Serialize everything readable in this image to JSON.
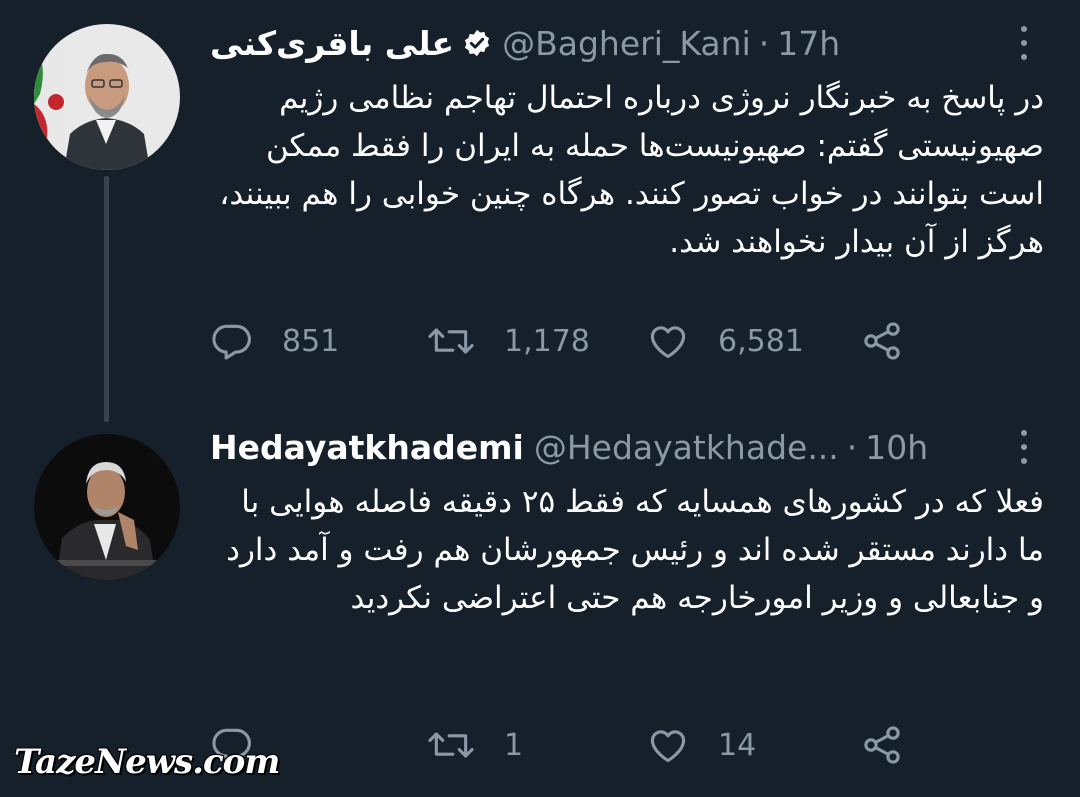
{
  "tweets": [
    {
      "display_name": "علی باقری‌کنی",
      "verified": true,
      "handle": "@Bagheri_Kani",
      "separator": "·",
      "time": "17h",
      "text": "در پاسخ به خبرنگار نروژی درباره احتمال تهاجم نظامی رژیم صهیونیستی گفتم: صهیونیست‌ها حمله به ایران را فقط ممکن است بتوانند در خواب تصور کنند. هرگاه چنین خوابی را هم ببینند، هرگز از آن بیدار نخواهند شد.",
      "replies": "851",
      "retweets": "1,178",
      "likes": "6,581"
    },
    {
      "display_name": "Hedayatkhademi",
      "verified": false,
      "handle": "@Hedayatkhade...",
      "separator": "·",
      "time": "10h",
      "text": "فعلا که در کشورهای همسایه که فقط ۲۵ دقیقه فاصله هوایی با ما دارند مستقر شده اند  و رئیس جمهورشان هم رفت و آمد دارد و جنابعالی و وزیر امورخارجه هم حتی اعتراضی نکردید",
      "replies": "",
      "retweets": "1",
      "likes": "14"
    }
  ],
  "watermark": "TazeNews.com",
  "colors": {
    "background": "#15202b",
    "secondary_text": "#8b98a5",
    "thread_line": "#38444d"
  }
}
